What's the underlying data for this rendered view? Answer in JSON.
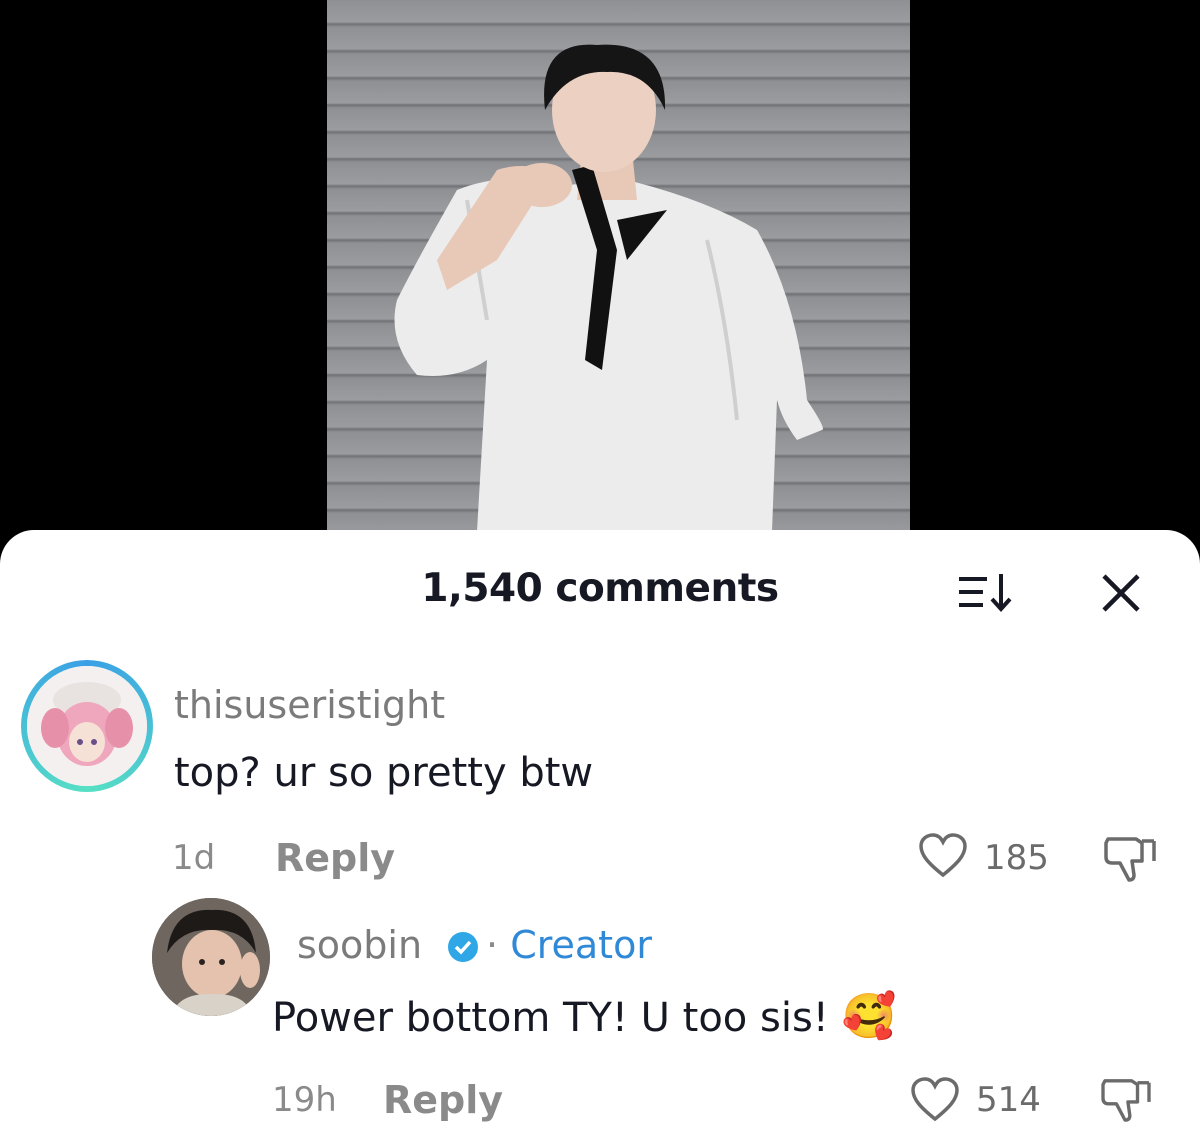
{
  "header": {
    "comments_count_label": "1,540 comments"
  },
  "icons": {
    "sort": "sort-descending-icon",
    "close": "close-icon",
    "like": "heart-outline-icon",
    "dislike": "thumbs-down-icon",
    "verified": "verified-badge-icon"
  },
  "comments": [
    {
      "username": "thisuseristight",
      "text": "top? ur so pretty btw",
      "time": "1d",
      "reply_label": "Reply",
      "likes": "185"
    },
    {
      "username": "soobin",
      "role_separator": "·",
      "role": "Creator",
      "text": "Power bottom TY! U too sis!",
      "emoji": "🥰",
      "time": "19h",
      "reply_label": "Reply",
      "likes": "514"
    }
  ],
  "colors": {
    "creator_blue": "#2f89d6",
    "text_primary": "#161823",
    "text_secondary": "#8a8a8a"
  }
}
